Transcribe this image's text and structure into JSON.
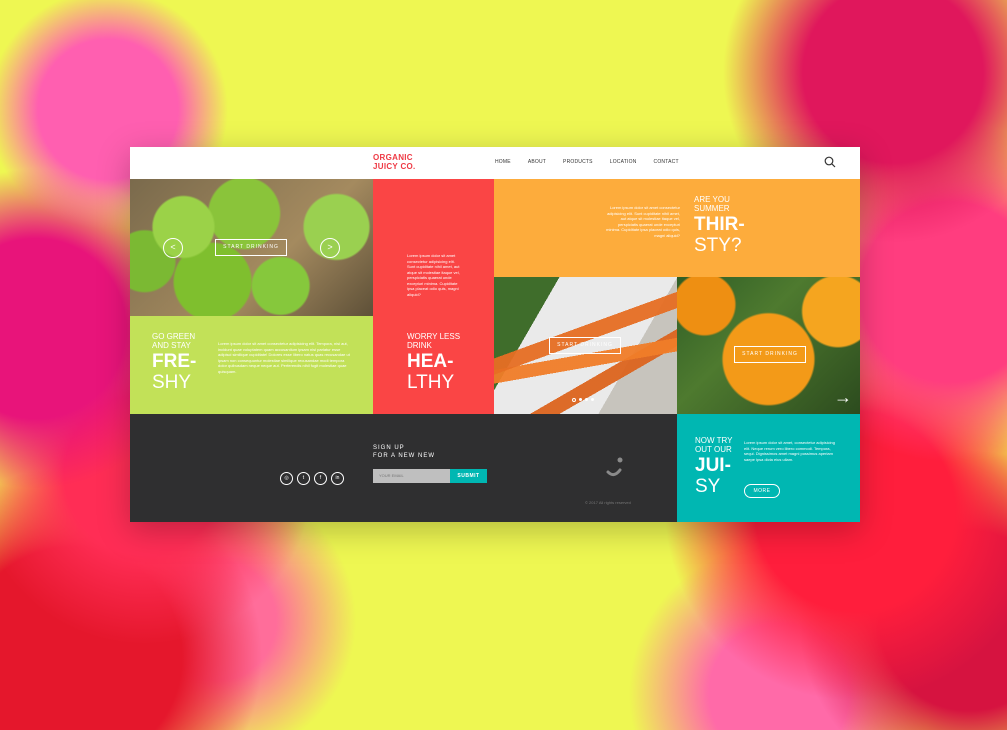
{
  "brand": {
    "line1": "ORGANIC",
    "line2": "JUICY CO."
  },
  "nav": [
    "HOME",
    "ABOUT",
    "PRODUCTS",
    "LOCATION",
    "CONTACT"
  ],
  "hero": {
    "cta": "START DRINKING",
    "prev": "<",
    "next": ">"
  },
  "green": {
    "small1": "GO GREEN",
    "small2": "AND STAY",
    "big1": "FRE-",
    "big2": "SHY",
    "text": "Lorem ipsum dolor sit amet consectetur adipisicing elit. Tempora, nisi aut, incidunt quae voluptatem quam accusantium ipsam nisi pariatur esse adipisci similique cupiditate! Dolores esse libero natus quas recusandae ut ipsam non consequuntur molestiae similique recusandae modi tempora dolor quibusdam neque neque aut. Perferendis nihil fugit molestiae quae quisquam."
  },
  "red": {
    "text": "Lorem ipsum dolor sit amet consectetur adipisicing elit. Sunt cupiditate nihil amet, aut atque sit molestiae itaque vel, perspiciatis quaerat unde excepturi minima. Cupiditate ipsa placeat odio quis, magni aliquid?",
    "small1": "WORRY LESS",
    "small2": "DRINK",
    "big1": "HEA-",
    "big2": "LTHY"
  },
  "orange": {
    "text": "Lorem ipsum dolor sit amet consectetur adipisicing elit. Sunt cupiditate nihil amet, aut atque sit molestiae itaque vel, perspiciatis quaerat unde excepturi minima. Cupiditate ipsa placeat odio quis, magni aliquid?",
    "small1": "ARE YOU",
    "small2": "SUMMER",
    "big1": "THIR-",
    "big2": "STY?"
  },
  "carrots": {
    "cta": "START DRINKING",
    "slide": 1,
    "slides": 4
  },
  "oranges": {
    "cta": "START DRINKING",
    "arrow": "→"
  },
  "signup": {
    "line1": "SIGN UP",
    "line2": "FOR A NEW NEW",
    "placeholder": "YOUR EMAIL",
    "submit": "SUBMIT"
  },
  "social": [
    "instagram-icon",
    "twitter-icon",
    "facebook-icon",
    "linkedin-icon"
  ],
  "copyright": "© 2017 All rights reserved",
  "teal": {
    "small1": "NOW TRY",
    "small2": "OUT OUR",
    "big1": "JUI-",
    "big2": "SY",
    "text": "Lorem ipsum dolor sit amet, consectetur adipisicing elit. Neque rerum vero libero commodi. Tempora, sequi. Dignissimos amet magni possimus aperiam saepe ipsa dicta eius ullam.",
    "more": "MORE"
  },
  "colors": {
    "red": "#fa4545",
    "orange": "#fdac3c",
    "green": "#c2e158",
    "teal": "#00b7b2",
    "dark": "#2f2f30"
  }
}
